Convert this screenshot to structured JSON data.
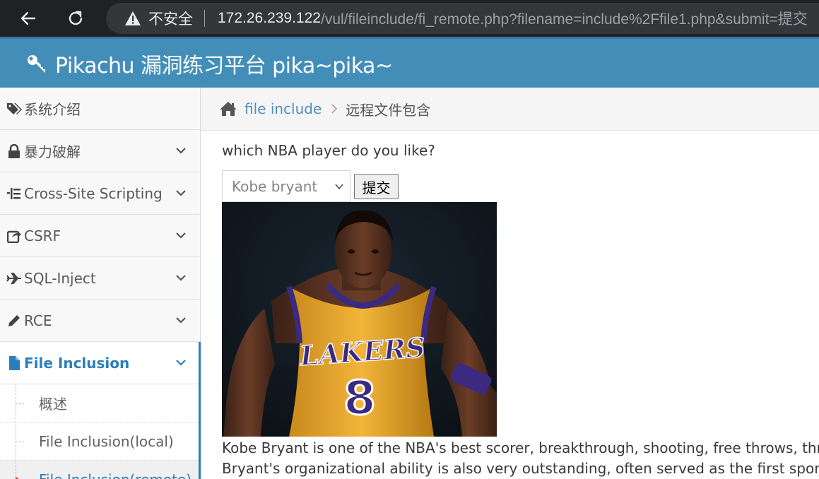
{
  "browser": {
    "security_label": "不安全",
    "url_host": "172.26.239.122",
    "url_path": "/vul/fileinclude/fi_remote.php?filename=include%2Ffile1.php&submit=提交"
  },
  "header": {
    "title": "Pikachu 漏洞练习平台 pika~pika~"
  },
  "sidebar": {
    "items": [
      {
        "label": "系统介绍",
        "icon": "tags-icon"
      },
      {
        "label": "暴力破解",
        "icon": "lock-icon"
      },
      {
        "label": "Cross-Site Scripting",
        "icon": "list-icon"
      },
      {
        "label": "CSRF",
        "icon": "share-icon"
      },
      {
        "label": "SQL-Inject",
        "icon": "plane-icon"
      },
      {
        "label": "RCE",
        "icon": "pencil-icon"
      },
      {
        "label": "File Inclusion",
        "icon": "file-icon"
      }
    ],
    "sub_items": [
      {
        "label": "概述"
      },
      {
        "label": "File Inclusion(local)"
      },
      {
        "label": "File Inclusion(remote)"
      }
    ]
  },
  "breadcrumb": {
    "parent": "file include",
    "current": "远程文件包含"
  },
  "form": {
    "question": "which NBA player do you like?",
    "selected_option": "Kobe bryant",
    "submit_label": "提交"
  },
  "content": {
    "image_alt": "Kobe Bryant in Lakers jersey number 8",
    "jersey_text": "LAKERS",
    "jersey_number": "8",
    "description_line1": "Kobe Bryant is one of the NBA's best scorer, breakthrough, shooting, free throws, three-pointer",
    "description_line2": "Bryant's organizational ability is also very outstanding, often served as the first sponsors on of"
  },
  "colors": {
    "header_bg": "#438eb9",
    "accent": "#2b7dbc",
    "browser_bg": "#202124"
  }
}
